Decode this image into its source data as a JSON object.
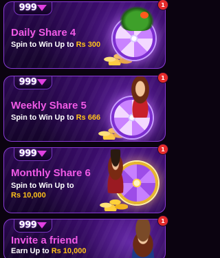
{
  "brand": {
    "logo_number": "999",
    "accent_color": "#f05ae6",
    "amount_color": "#ffc21a",
    "badge_color": "#e52b2b",
    "card_border_color": "#8a3bd6"
  },
  "cards": [
    {
      "logo": "999",
      "title": "Daily Share 4",
      "subtitle_prefix": "Spin to Win Up to",
      "amount": "Rs 300",
      "badge": "1",
      "art": "spin-wheel-with-dragon"
    },
    {
      "logo": "999",
      "title": "Weekly Share 5",
      "subtitle_prefix": "Spin to Win Up to",
      "amount": "Rs 666",
      "badge": "1",
      "art": "spin-wheel-with-woman"
    },
    {
      "logo": "999",
      "title": "Monthly Share 6",
      "subtitle_prefix": "Spin to Win Up to",
      "amount": "Rs 10,000",
      "badge": "1",
      "art": "gold-spin-wheel-with-pirate"
    },
    {
      "logo": "999",
      "title": "Invite a friend",
      "subtitle_prefix": "Earn Up to",
      "amount": "Rs 10,000",
      "badge": "1",
      "art": "pilot-character"
    }
  ]
}
